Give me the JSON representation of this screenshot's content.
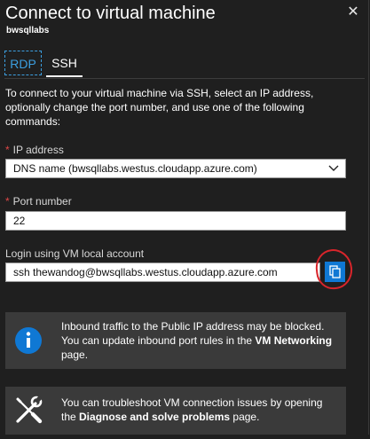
{
  "header": {
    "title": "Connect to virtual machine",
    "subtitle": "bwsqllabs",
    "close_glyph": "✕"
  },
  "tabs": [
    {
      "label": "RDP",
      "selected": false
    },
    {
      "label": "SSH",
      "selected": true
    }
  ],
  "intro_text": "To connect to your virtual machine via SSH, select an IP address, optionally change the port number, and use one of the following commands:",
  "ip_address": {
    "label": "IP address",
    "required": true,
    "selected_value": "DNS name (bwsqllabs.westus.cloudapp.azure.com)"
  },
  "port_number": {
    "label": "Port number",
    "required": true,
    "value": "22"
  },
  "login": {
    "label": "Login using VM local account",
    "command": "ssh thewandog@bwsqllabs.westus.cloudapp.azure.com",
    "copy_icon": "copy-icon"
  },
  "inbound_notice": {
    "icon": "info-icon",
    "text_before": "Inbound traffic to the Public IP address may be blocked. You can update inbound port rules in the ",
    "link_text": "VM Networking",
    "text_after": " page."
  },
  "troubleshoot_notice": {
    "icon": "tools-icon",
    "text_before": "You can troubleshoot VM connection issues by opening the ",
    "link_text": "Diagnose and solve problems",
    "text_after": " page."
  },
  "colors": {
    "background": "#1f1f1f",
    "accent": "#0f78d4",
    "tab_rdp": "#3c9fe0",
    "required": "#e04848",
    "annotation": "#d8252b",
    "notice_bg": "#3a3a3a"
  }
}
